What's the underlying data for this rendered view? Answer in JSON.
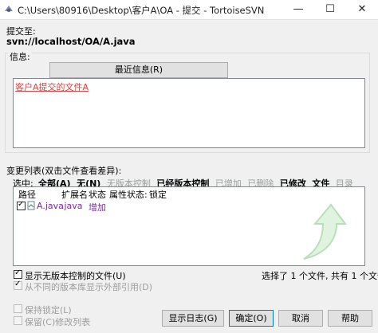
{
  "window": {
    "title": "C:\\Users\\80916\\Desktop\\客户A\\OA - 提交 - TortoiseSVN",
    "minimize": "—",
    "maximize": "☐",
    "close": "✕"
  },
  "commit_to": {
    "label": "提交至:",
    "url": "svn://localhost/OA/A.java"
  },
  "message": {
    "label": "信息:",
    "recent_button": "最近信息(R)",
    "text": "客户A提交的文件A"
  },
  "changes": {
    "label": "变更列表(双击文件查看差异):",
    "filter_label": "选中:",
    "filters": [
      {
        "text": "全部(A)",
        "style": "bold"
      },
      {
        "text": "无(N)",
        "style": "bold"
      },
      {
        "text": "无版本控制",
        "style": "grey"
      },
      {
        "text": "已经版本控制",
        "style": "bold"
      },
      {
        "text": "已增加",
        "style": "grey"
      },
      {
        "text": "已删除",
        "style": "grey"
      },
      {
        "text": "已修改",
        "style": "bold"
      },
      {
        "text": "文件",
        "style": "bold"
      },
      {
        "text": "目录",
        "style": "grey"
      }
    ],
    "columns": [
      "路径",
      "扩展名",
      "状态",
      "属性状态:",
      "锁定"
    ],
    "rows": [
      {
        "path": "A.java",
        "ext": ".java",
        "status": "增加",
        "prop_status": "",
        "lock": "",
        "checked": true
      }
    ],
    "selection_summary": "选择了 1 个文件, 共有 1 个文件"
  },
  "options": {
    "show_unversioned": "显示无版本控制的文件(U)",
    "show_externals": "从不同的版本库显示外部引用(D)",
    "keep_locks": "保持锁定(L)",
    "keep_changelists": "保留(C)修改列表"
  },
  "buttons": {
    "show_log": "显示日志(G)",
    "ok": "确定(O)",
    "cancel": "取消",
    "help": "帮助"
  },
  "colors": {
    "link_red": "#e03e3e",
    "purple_text": "#7a2aa3",
    "grey_text": "#9d9d9d"
  }
}
